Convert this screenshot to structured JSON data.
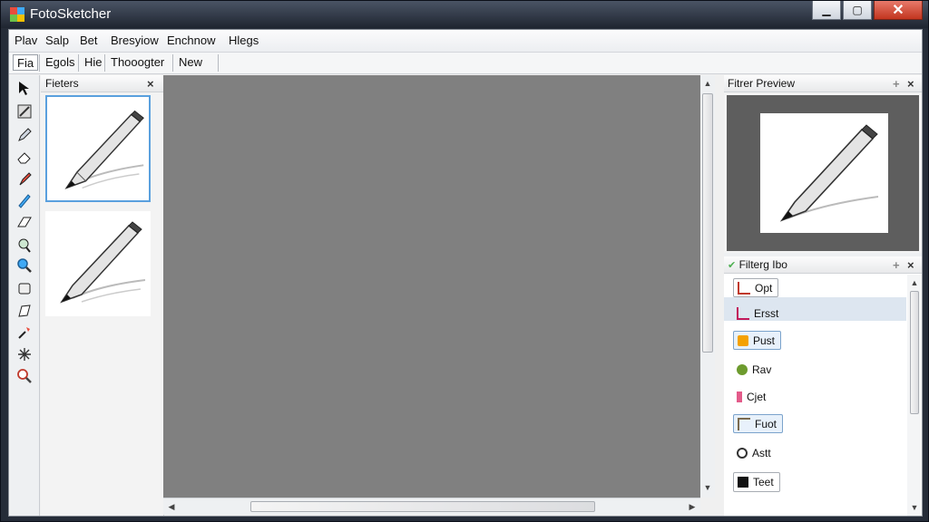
{
  "window": {
    "title": "FotoSketcher"
  },
  "menu": [
    "Plav",
    "Salp",
    "Bet",
    "Bresyiow",
    "Enchnow",
    "Hlegs"
  ],
  "toolbar": [
    "Fia",
    "Egols",
    "Hie",
    "Thooogter",
    "New"
  ],
  "tools": [
    "arrow-pointer-icon",
    "crop-icon",
    "pen-icon",
    "eraser-icon",
    "brush-icon",
    "pencil-icon",
    "shape-icon",
    "lasso-icon",
    "zoom-icon",
    "layer-icon",
    "transform-icon",
    "magic-icon",
    "magnifier-icon",
    "zoom-tool-icon"
  ],
  "filters_panel": {
    "title": "Fieters",
    "close": "×"
  },
  "preview_panel": {
    "title": "Fitrer Preview",
    "pin": "+",
    "close": "×"
  },
  "info_panel": {
    "title": "Filterg Ibo",
    "pin": "+",
    "close": "×",
    "items": [
      {
        "label": "Opt",
        "color": "#c0392b"
      },
      {
        "label": "Ersst",
        "color": "#c2185b"
      },
      {
        "label": "Pust",
        "color": "#f4a100"
      },
      {
        "label": "Rav",
        "color": "#6d9b2e"
      },
      {
        "label": "Cjet",
        "color": "#e35b8a"
      },
      {
        "label": "Fuot",
        "color": "#7a6a4f"
      },
      {
        "label": "Astt",
        "color": "#333333"
      },
      {
        "label": "Teet",
        "color": "#111111"
      }
    ]
  },
  "colors": {
    "canvas": "#808080",
    "accent": "#5aa0de",
    "titlebar": "#2a313d"
  }
}
